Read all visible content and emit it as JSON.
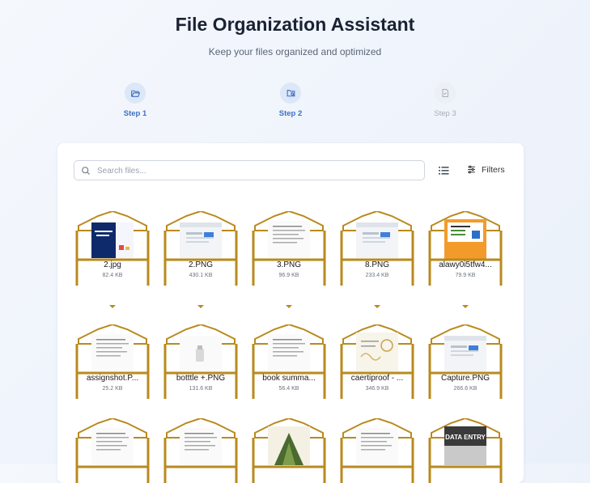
{
  "header": {
    "title": "File Organization Assistant",
    "subtitle": "Keep your files organized and optimized"
  },
  "steps": [
    {
      "label": "Step 1",
      "icon": "folder-open-icon",
      "state": "done"
    },
    {
      "label": "Step 2",
      "icon": "folder-search-icon",
      "state": "active"
    },
    {
      "label": "Step 3",
      "icon": "file-check-icon",
      "state": "inactive"
    }
  ],
  "toolbar": {
    "search_placeholder": "Search files...",
    "filters_label": "Filters"
  },
  "colors": {
    "accent": "#3d6fc4",
    "folder": "#b98a1e"
  },
  "files": [
    {
      "name": "2.jpg",
      "size": "82.4 KB",
      "thumb": "dark-blue"
    },
    {
      "name": "2.PNG",
      "size": "430.1 KB",
      "thumb": "screen"
    },
    {
      "name": "3.PNG",
      "size": "96.9 KB",
      "thumb": "doc"
    },
    {
      "name": "8.PNG",
      "size": "233.4 KB",
      "thumb": "screen"
    },
    {
      "name": "alawy0i5tfw4...",
      "size": "79.9 KB",
      "thumb": "orange"
    },
    {
      "name": "assignshot.P...",
      "size": "25.2 KB",
      "thumb": "doc"
    },
    {
      "name": "botttle +.PNG",
      "size": "131.6 KB",
      "thumb": "bottle"
    },
    {
      "name": "book summa...",
      "size": "56.4 KB",
      "thumb": "doc"
    },
    {
      "name": "caertiproof - ...",
      "size": "346.9 KB",
      "thumb": "certificate"
    },
    {
      "name": "Capture.PNG",
      "size": "266.6 KB",
      "thumb": "screen"
    },
    {
      "name": "",
      "size": "",
      "thumb": "doc"
    },
    {
      "name": "",
      "size": "",
      "thumb": "doc"
    },
    {
      "name": "",
      "size": "",
      "thumb": "green"
    },
    {
      "name": "",
      "size": "",
      "thumb": "doc"
    },
    {
      "name": "",
      "size": "",
      "thumb": "data-entry",
      "thumb_text": "DATA ENTRY"
    }
  ]
}
